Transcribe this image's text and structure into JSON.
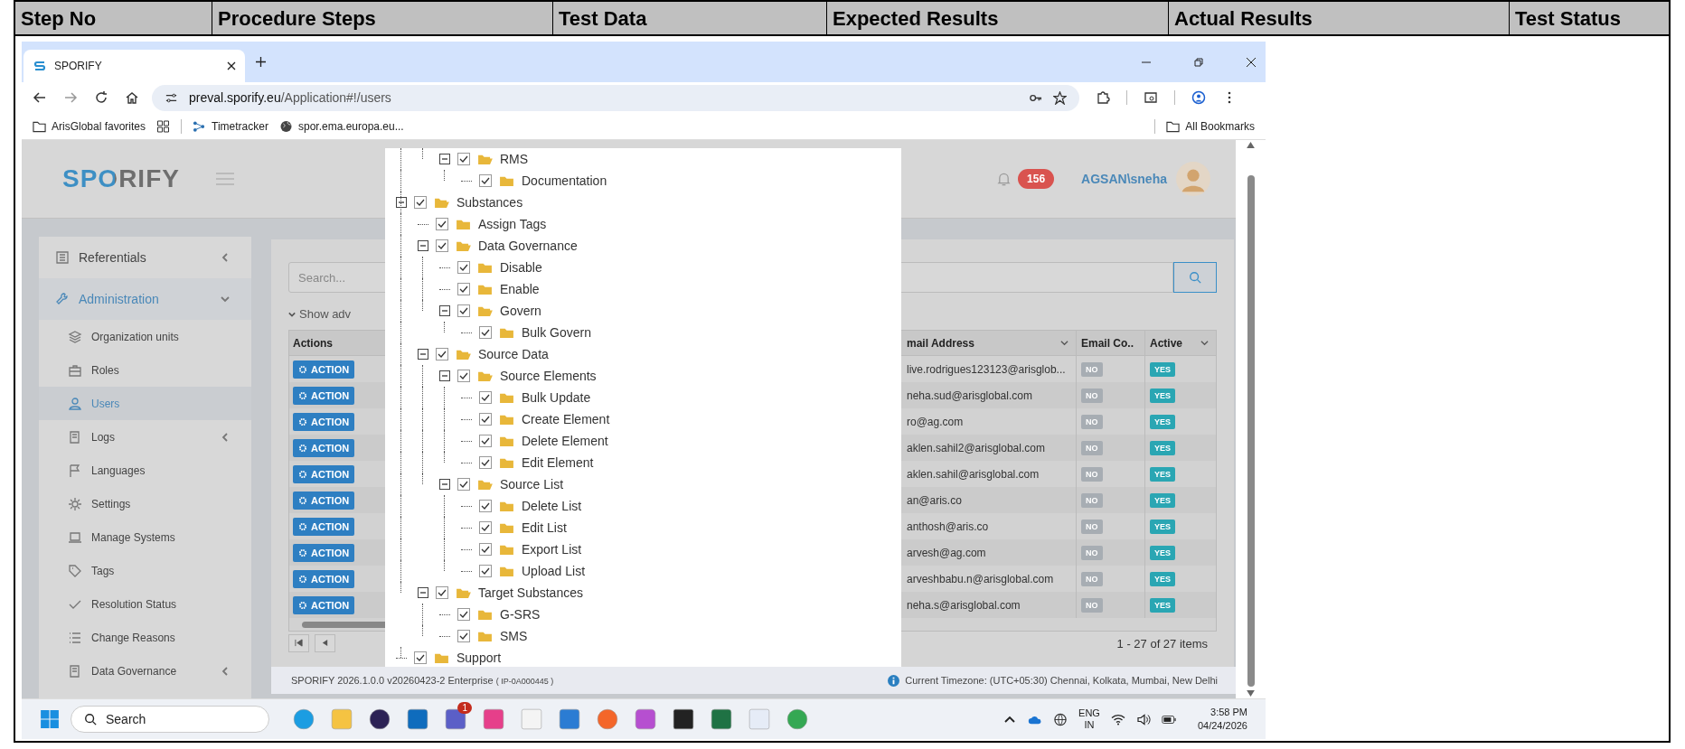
{
  "doc_table": {
    "columns": [
      "Step No",
      "Procedure Steps",
      "Test Data",
      "Expected Results",
      "Actual Results",
      "Test Status"
    ]
  },
  "browser": {
    "tab_title": "SPORIFY",
    "url_host": "preval.sporify.eu",
    "url_path": "/Application#!/users",
    "bookmarks": [
      "ArisGlobal favorites",
      "Timetracker",
      "spor.ema.europa.eu..."
    ],
    "all_bookmarks": "All Bookmarks"
  },
  "app": {
    "logo": "SPORIFY",
    "notification_count": "156",
    "user": "AGSAN\\sneha",
    "sidebar": {
      "items": [
        {
          "label": "Referentials",
          "selected": false,
          "expanded": false
        },
        {
          "label": "Administration",
          "selected": true,
          "expanded": true,
          "children": [
            {
              "label": "Organization units",
              "selected": false
            },
            {
              "label": "Roles",
              "selected": false
            },
            {
              "label": "Users",
              "selected": true
            },
            {
              "label": "Logs",
              "selected": false,
              "expanded": false
            },
            {
              "label": "Languages",
              "selected": false
            },
            {
              "label": "Settings",
              "selected": false
            },
            {
              "label": "Manage Systems",
              "selected": false
            },
            {
              "label": "Tags",
              "selected": false
            },
            {
              "label": "Resolution Status",
              "selected": false
            },
            {
              "label": "Change Reasons",
              "selected": false
            },
            {
              "label": "Data Governance",
              "selected": false,
              "expanded": false
            }
          ]
        }
      ]
    },
    "search": {
      "placeholder": "Search..."
    },
    "show_advanced": "Show adv",
    "table": {
      "columns": [
        "Actions",
        "mail Address",
        "Email Co..",
        "Active"
      ],
      "rows": [
        {
          "action": "ACTION",
          "email": "live.rodrigues123123@arisglob...",
          "email_confirmed": "NO",
          "active": "YES"
        },
        {
          "action": "ACTION",
          "email": "neha.sud@arisglobal.com",
          "email_confirmed": "NO",
          "active": "YES"
        },
        {
          "action": "ACTION",
          "email": "ro@ag.com",
          "email_confirmed": "NO",
          "active": "YES"
        },
        {
          "action": "ACTION",
          "email": "aklen.sahil2@arisglobal.com",
          "email_confirmed": "NO",
          "active": "YES"
        },
        {
          "action": "ACTION",
          "email": "aklen.sahil@arisglobal.com",
          "email_confirmed": "NO",
          "active": "YES"
        },
        {
          "action": "ACTION",
          "email": "an@aris.co",
          "email_confirmed": "NO",
          "active": "YES"
        },
        {
          "action": "ACTION",
          "email": "anthosh@aris.co",
          "email_confirmed": "NO",
          "active": "YES"
        },
        {
          "action": "ACTION",
          "email": "arvesh@ag.com",
          "email_confirmed": "NO",
          "active": "YES"
        },
        {
          "action": "ACTION",
          "email": "arveshbabu.n@arisglobal.com",
          "email_confirmed": "NO",
          "active": "YES"
        },
        {
          "action": "ACTION",
          "email": "neha.s@arisglobal.com",
          "email_confirmed": "NO",
          "active": "YES"
        }
      ]
    },
    "pagination": "1 - 27 of 27 items",
    "footer": {
      "version": "SPORIFY 2026.1.0.0 v20260423-2 Enterprise",
      "ip": "( IP-0A000445 )",
      "timezone": "Current Timezone: (UTC+05:30) Chennai, Kolkata, Mumbai, New Delhi"
    }
  },
  "tree": {
    "cut_branch": [
      {
        "label": "RMS",
        "checked": true,
        "expanded": true,
        "children": [
          {
            "label": "Documentation",
            "checked": true
          }
        ]
      }
    ],
    "items": [
      {
        "label": "Substances",
        "checked": true,
        "expanded": true,
        "children": [
          {
            "label": "Assign Tags",
            "checked": true
          },
          {
            "label": "Data Governance",
            "checked": true,
            "expanded": true,
            "children": [
              {
                "label": "Disable",
                "checked": true
              },
              {
                "label": "Enable",
                "checked": true
              },
              {
                "label": "Govern",
                "checked": true,
                "expanded": true,
                "children": [
                  {
                    "label": "Bulk Govern",
                    "checked": true
                  }
                ]
              }
            ]
          },
          {
            "label": "Source Data",
            "checked": true,
            "expanded": true,
            "children": [
              {
                "label": "Source Elements",
                "checked": true,
                "expanded": true,
                "children": [
                  {
                    "label": "Bulk Update",
                    "checked": true
                  },
                  {
                    "label": "Create Element",
                    "checked": true
                  },
                  {
                    "label": "Delete Element",
                    "checked": true
                  },
                  {
                    "label": "Edit Element",
                    "checked": true
                  }
                ]
              },
              {
                "label": "Source List",
                "checked": true,
                "expanded": true,
                "children": [
                  {
                    "label": "Delete List",
                    "checked": true
                  },
                  {
                    "label": "Edit List",
                    "checked": true
                  },
                  {
                    "label": "Export List",
                    "checked": true
                  },
                  {
                    "label": "Upload List",
                    "checked": true
                  }
                ]
              }
            ]
          },
          {
            "label": "Target Substances",
            "checked": true,
            "expanded": true,
            "children": [
              {
                "label": "G-SRS",
                "checked": true
              },
              {
                "label": "SMS",
                "checked": true
              }
            ]
          }
        ]
      },
      {
        "label": "Support",
        "checked": true
      }
    ]
  },
  "taskbar": {
    "search_placeholder": "Search",
    "teams_badge": "1",
    "language": "ENG",
    "region": "IN",
    "time": "3:58 PM",
    "date": "04/24/2026"
  }
}
